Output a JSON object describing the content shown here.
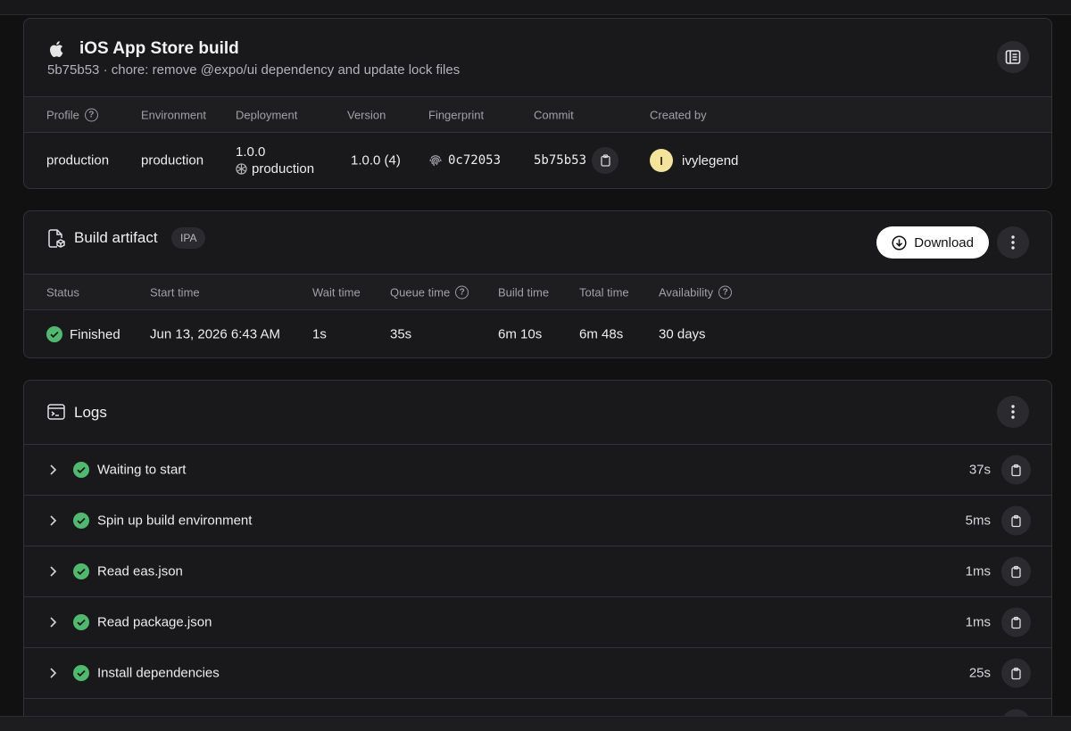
{
  "build": {
    "title": "iOS App Store build",
    "commit_hash": "5b75b53",
    "commit_message": "chore: remove @expo/ui dependency and update lock files",
    "separator": "·",
    "columns": {
      "profile": "Profile",
      "environment": "Environment",
      "deployment": "Deployment",
      "version": "Version",
      "fingerprint": "Fingerprint",
      "commit": "Commit",
      "created_by": "Created by"
    },
    "values": {
      "profile": "production",
      "environment": "production",
      "deployment_version": "1.0.0",
      "deployment_channel": "production",
      "version": "1.0.0 (4)",
      "fingerprint": "0c72053",
      "commit": "5b75b53",
      "avatar_initial": "I",
      "created_by": "ivylegend"
    }
  },
  "artifact": {
    "title": "Build artifact",
    "badge": "IPA",
    "download_label": "Download",
    "columns": {
      "status": "Status",
      "start_time": "Start time",
      "wait_time": "Wait time",
      "queue_time": "Queue time",
      "build_time": "Build time",
      "total_time": "Total time",
      "availability": "Availability"
    },
    "values": {
      "status": "Finished",
      "start_time": "Jun 13, 2026 6:43 AM",
      "wait_time": "1s",
      "queue_time": "35s",
      "build_time": "6m 10s",
      "total_time": "6m 48s",
      "availability": "30 days"
    }
  },
  "logs": {
    "title": "Logs",
    "steps": [
      {
        "label": "Waiting to start",
        "duration": "37s"
      },
      {
        "label": "Spin up build environment",
        "duration": "5ms"
      },
      {
        "label": "Read eas.json",
        "duration": "1ms"
      },
      {
        "label": "Read package.json",
        "duration": "1ms"
      },
      {
        "label": "Install dependencies",
        "duration": "25s"
      }
    ]
  },
  "colors": {
    "success": "#4fba6f",
    "background": "#111112",
    "card": "#19191b"
  }
}
